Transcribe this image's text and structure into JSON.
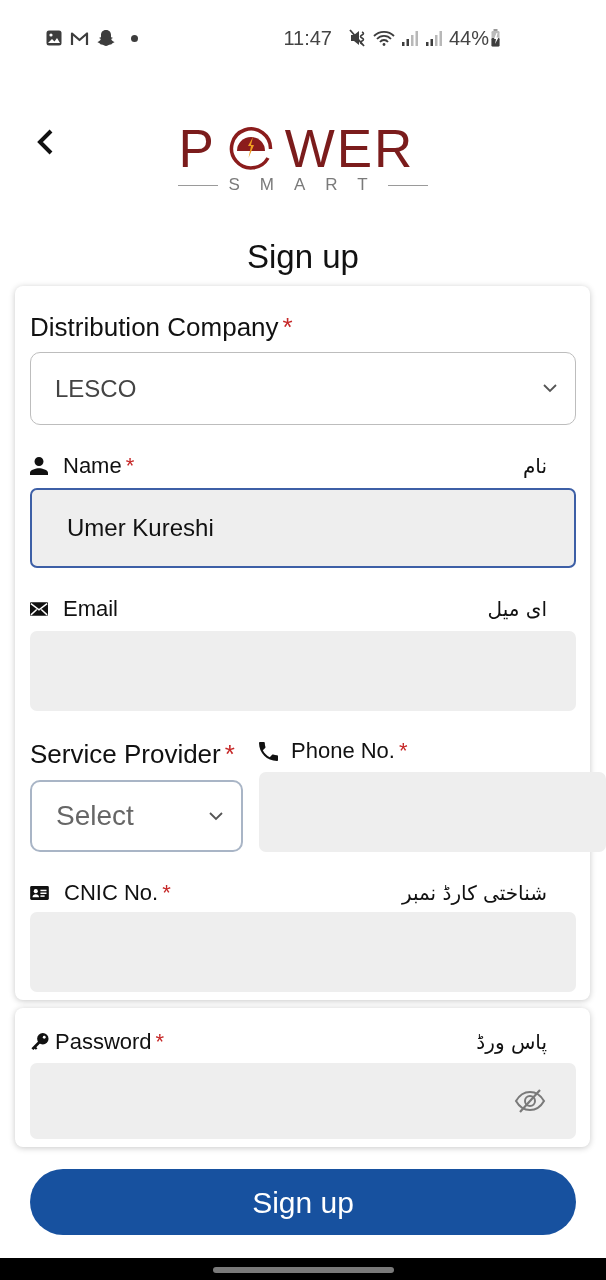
{
  "status_bar": {
    "time": "11:47",
    "battery": "44%"
  },
  "header": {
    "logo": {
      "text_start": "P",
      "text_end": "WER",
      "tagline": "SMART"
    },
    "title": "Sign up"
  },
  "sections": [
    {
      "fields": [
        {
          "kind": "select",
          "label": "Distribution Company",
          "required_mark": "*",
          "value": "LESCO"
        },
        {
          "kind": "name",
          "label": "Name",
          "required_mark": "*",
          "urdu_label": "نام",
          "value": "Umer Kureshi",
          "focused": true
        },
        {
          "kind": "email",
          "label": "Email",
          "urdu_label": "ای میل",
          "focused": false
        },
        {
          "kind": "provider_phone",
          "provider": {
            "label": "Service Provider",
            "required_mark": "*",
            "placeholder": "Select"
          },
          "phone": {
            "label": "Phone No.",
            "required_mark": "*",
            "focused": false
          }
        },
        {
          "kind": "cnic",
          "label": "CNIC No.",
          "required_mark": "*",
          "urdu_label": "شناختی کارڈ نمبر",
          "focused": false
        }
      ]
    },
    {
      "fields": [
        {
          "kind": "password",
          "label": "Password",
          "required_mark": "*",
          "urdu_label": "پاس ورڈ",
          "focused": false,
          "password_visible": false
        }
      ]
    }
  ],
  "submit_button": {
    "label": "Sign up"
  }
}
